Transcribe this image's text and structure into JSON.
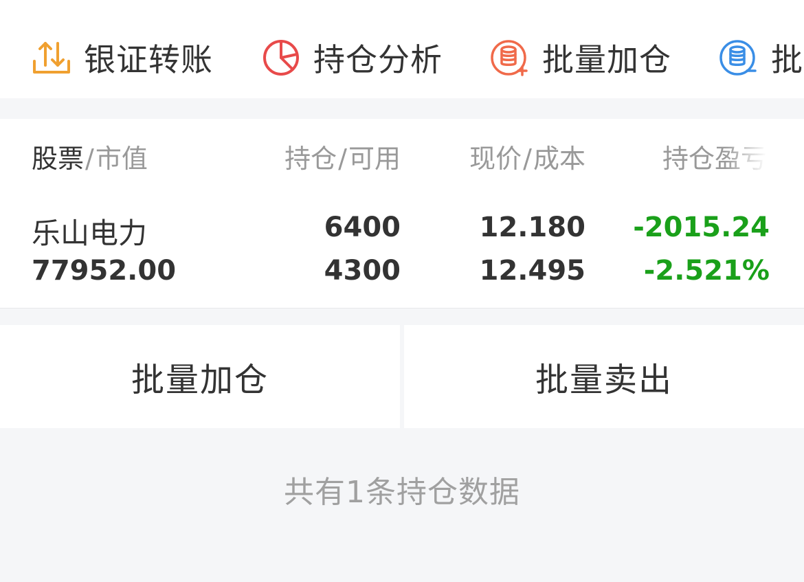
{
  "toolbar": {
    "actions": [
      {
        "label": "银证转账",
        "icon": "transfer-icon",
        "color": "#f0a030"
      },
      {
        "label": "持仓分析",
        "icon": "pie-chart-icon",
        "color": "#e84a4a"
      },
      {
        "label": "批量加仓",
        "icon": "database-plus-icon",
        "color": "#f06a4a"
      },
      {
        "label": "批量减仓",
        "icon": "database-minus-icon",
        "color": "#3a8ee6"
      }
    ]
  },
  "table": {
    "headers": {
      "stock_main": "股票",
      "stock_sub": "市值",
      "position_main": "持仓",
      "position_sub": "可用",
      "price_main": "现价",
      "price_sub": "成本",
      "pl": "持仓盈亏"
    },
    "separator": "/",
    "rows": [
      {
        "name": "乐山电力",
        "market_value": "77952.00",
        "position": "6400",
        "available": "4300",
        "current_price": "12.180",
        "cost": "12.495",
        "pl_amount": "-2015.24",
        "pl_percent": "-2.521%"
      }
    ]
  },
  "buttons": {
    "batch_add": "批量加仓",
    "batch_sell": "批量卖出"
  },
  "summary": "共有1条持仓数据",
  "colors": {
    "loss": "#1aa01a",
    "text_primary": "#333333",
    "text_secondary": "#999999",
    "background": "#f5f6f8"
  }
}
